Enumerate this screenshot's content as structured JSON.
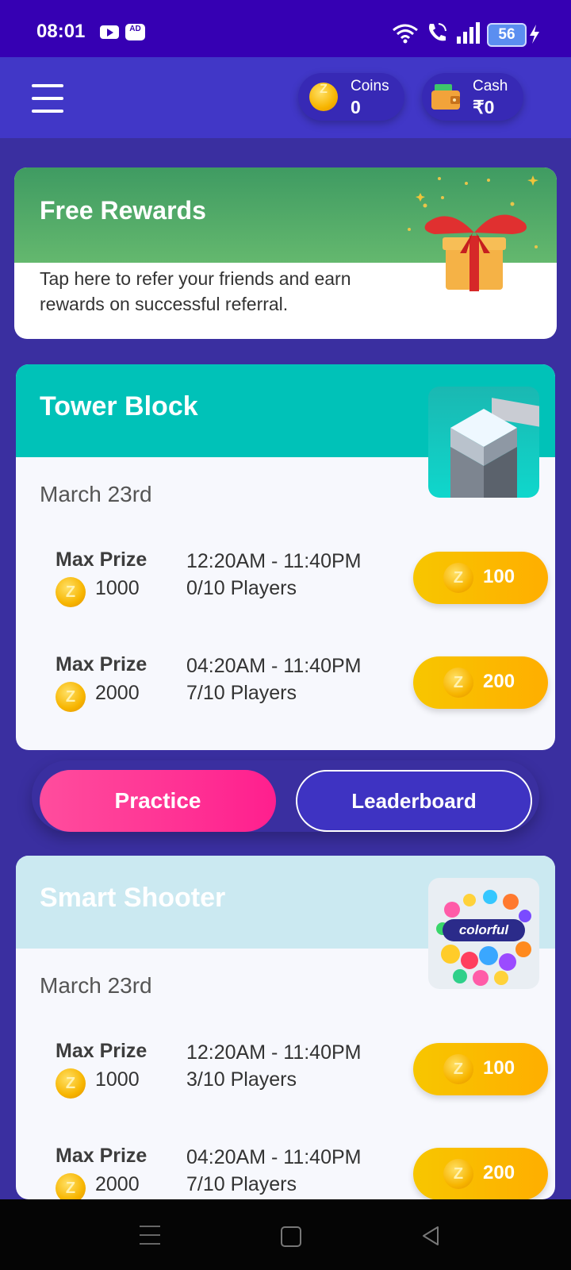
{
  "status_bar": {
    "time": "08:01",
    "ad_badge": "AD",
    "battery": "56"
  },
  "header": {
    "coins": {
      "label": "Coins",
      "value": "0"
    },
    "cash": {
      "label": "Cash",
      "value": "₹0"
    }
  },
  "rewards": {
    "title": "Free Rewards",
    "description": "Tap here to refer your friends and earn rewards on successful referral."
  },
  "games": [
    {
      "title": "Tower Block",
      "date": "March 23rd",
      "slots": [
        {
          "max_label": "Max Prize",
          "prize": "1000",
          "time": "12:20AM - 11:40PM",
          "players": "0/10 Players",
          "entry": "100"
        },
        {
          "max_label": "Max Prize",
          "prize": "2000",
          "time": "04:20AM - 11:40PM",
          "players": "7/10 Players",
          "entry": "200"
        }
      ]
    },
    {
      "title": "Smart Shooter",
      "date": "March 23rd",
      "thumb_text": "colorful",
      "slots": [
        {
          "max_label": "Max Prize",
          "prize": "1000",
          "time": "12:20AM - 11:40PM",
          "players": "3/10 Players",
          "entry": "100"
        },
        {
          "max_label": "Max Prize",
          "prize": "2000",
          "time": "04:20AM - 11:40PM",
          "players": "7/10 Players",
          "entry": "200"
        }
      ]
    }
  ],
  "actions": {
    "practice": "Practice",
    "leaderboard": "Leaderboard"
  },
  "colors": {
    "status_bar": "#3600b3",
    "header": "#4137c7",
    "background": "#3a2fa0",
    "rewards_green": "#4fa765",
    "tower_teal": "#00c2b8",
    "shooter_light": "#cbe9f1",
    "entry_yellow": "#ffbb00",
    "practice_pink": "#ff2f94"
  },
  "icons": [
    "menu-icon",
    "coin-icon",
    "wallet-icon",
    "gift-icon",
    "wifi-icon",
    "call-icon",
    "signal-icon",
    "charge-icon",
    "youtube-icon"
  ]
}
